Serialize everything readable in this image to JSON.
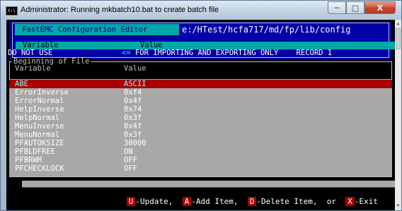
{
  "window": {
    "title": "Administrator:  Running mkbatch10.bat to create batch file",
    "app_icon_text": "C:\\",
    "min_glyph": "─",
    "max_glyph": "□",
    "close_glyph": "X"
  },
  "editor": {
    "title": " FastEMC Configuration Editor ",
    "path": "e:/HTest/hcfa717/md/fp/lib/config"
  },
  "columns": {
    "variable": "Variable",
    "value": "Value"
  },
  "record": {
    "name": "DO NOT USE",
    "arrow": "<=",
    "note": "FOR IMPORTING AND EXPORTING ONLY    RECORD 1"
  },
  "section": {
    "title": "Beginning of File",
    "var_header": "Variable",
    "val_header": "Value"
  },
  "rows": [
    {
      "var": "ABE",
      "val": "ASCII"
    },
    {
      "var": "ErrorInverse",
      "val": "0xf4"
    },
    {
      "var": "ErrorNormal",
      "val": "0x4f"
    },
    {
      "var": "HelpInverse",
      "val": "0x74"
    },
    {
      "var": "HelpNormal",
      "val": "0x3f"
    },
    {
      "var": "MenuInverse",
      "val": "0x4f"
    },
    {
      "var": "MenuNormal",
      "val": "0x3f"
    },
    {
      "var": "PFAUTOKSIZE",
      "val": "30000"
    },
    {
      "var": "PFBLDFREE",
      "val": "ON"
    },
    {
      "var": "PFBRWM",
      "val": "OFF"
    },
    {
      "var": "PFCHECKLOCK",
      "val": "OFF"
    }
  ],
  "commands": {
    "update_key": "U",
    "update_label": "-Update,",
    "add_key": "A",
    "add_label": "-Add Item,",
    "delete_key": "D",
    "delete_label": "-Delete Item,",
    "or_text": "or",
    "exit_key": "X",
    "exit_label": "-Exit"
  },
  "colors": {
    "header_bg": "#0000a8",
    "cyan": "#00a8a8",
    "list_bg": "#a8a8a8",
    "selection": "#a80000"
  },
  "selected_index": 0
}
